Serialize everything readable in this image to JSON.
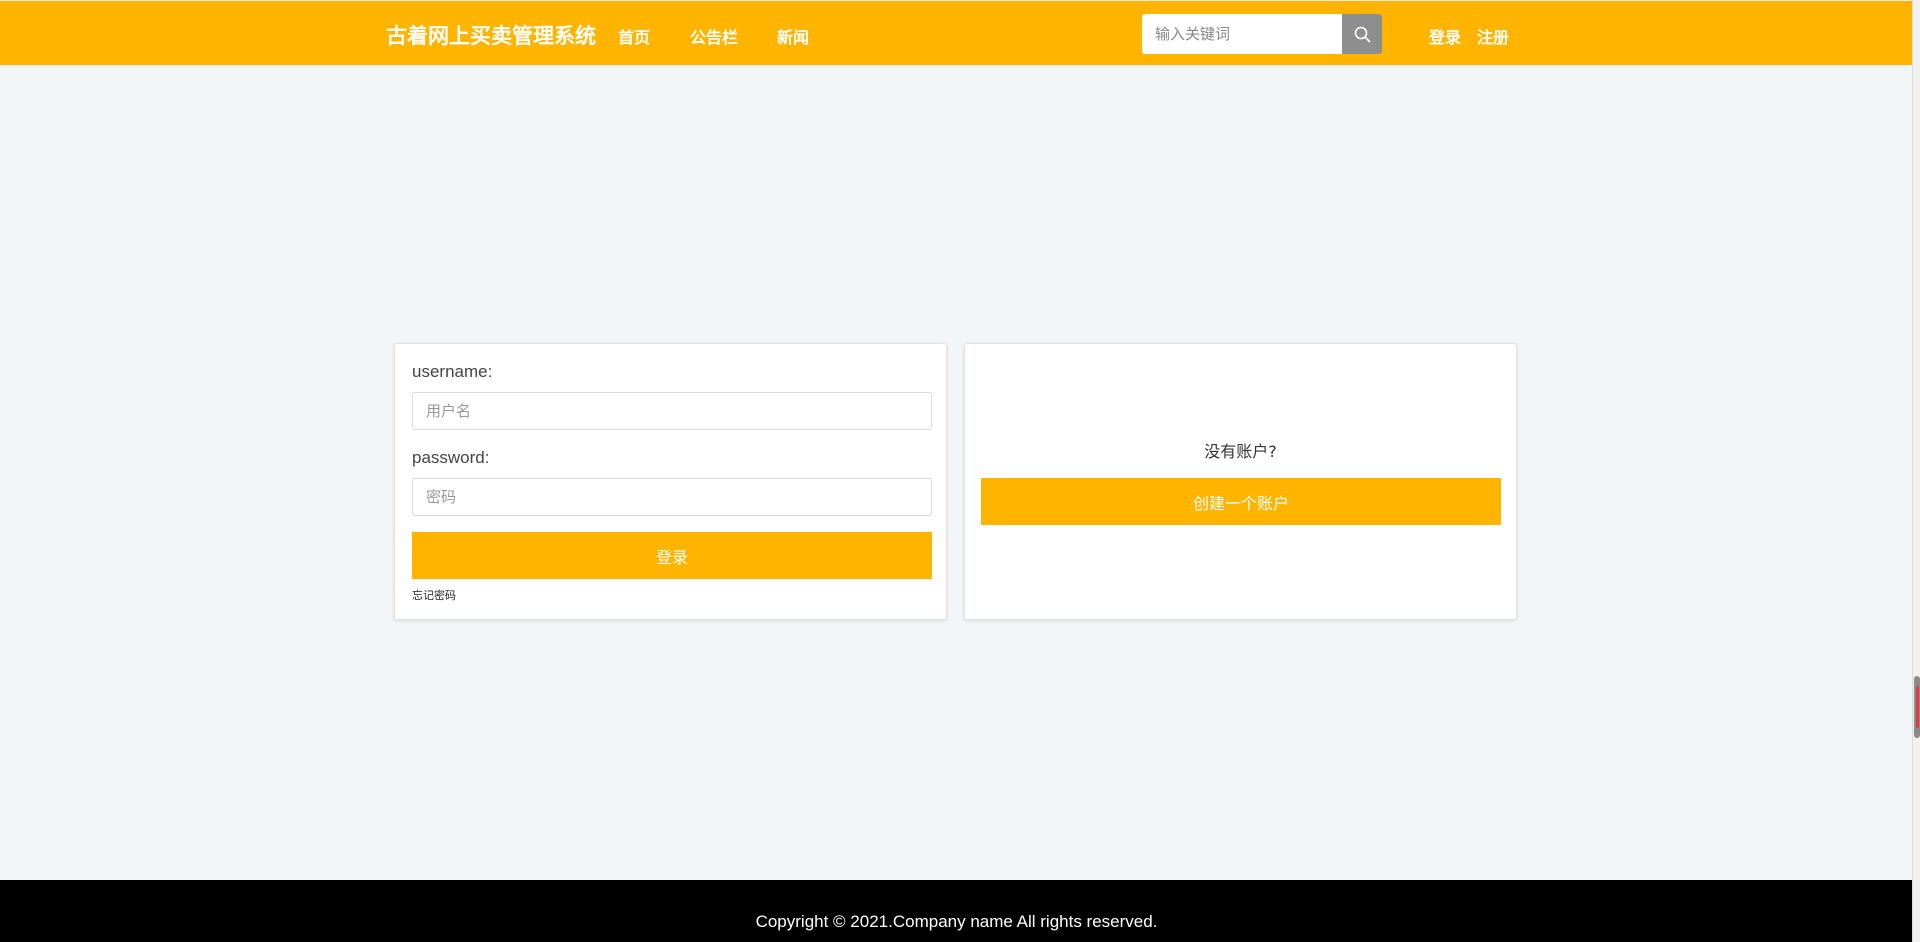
{
  "header": {
    "brand": "古着网上买卖管理系统",
    "nav": [
      {
        "label": "首页"
      },
      {
        "label": "公告栏"
      },
      {
        "label": "新闻"
      }
    ],
    "search": {
      "placeholder": "输入关键词",
      "value": "",
      "icon": "search-icon"
    },
    "login_label": "登录",
    "register_label": "注册"
  },
  "login_panel": {
    "username_label": "username:",
    "username_placeholder": "用户名",
    "password_label": "password:",
    "password_placeholder": "密码",
    "submit_label": "登录",
    "forgot_label": "忘记密码"
  },
  "register_panel": {
    "prompt": "没有账户?",
    "create_label": "创建一个账户"
  },
  "footer": {
    "copyright": "Copyright © 2021.Company name All rights reserved."
  },
  "colors": {
    "accent": "#ffb400",
    "background": "#f3f6f8",
    "footer": "#000000",
    "search_button": "#8e8e8e"
  }
}
